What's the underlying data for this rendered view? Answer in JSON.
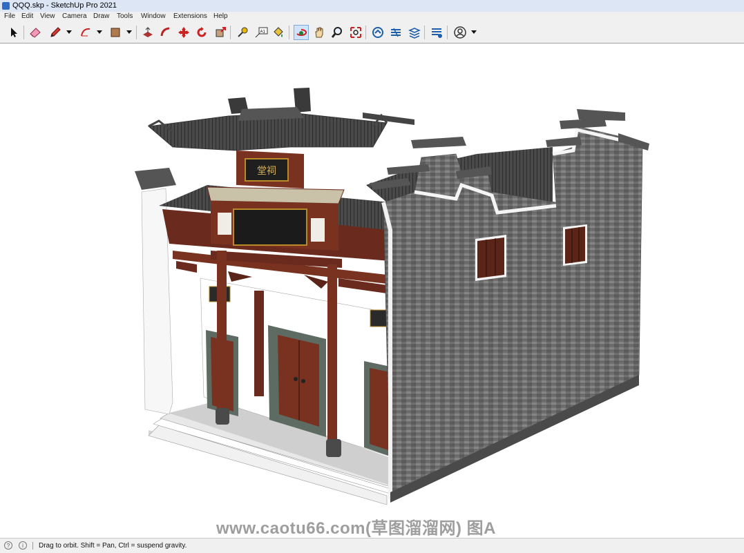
{
  "window": {
    "title": "QQQ.skp - SketchUp Pro 2021"
  },
  "menu": [
    "File",
    "Edit",
    "View",
    "Camera",
    "Draw",
    "Tools",
    "Window",
    "Extensions",
    "Help"
  ],
  "toolbar": {
    "tools": [
      "select-icon",
      "eraser-icon",
      "pencil-icon",
      "arc-icon",
      "rectangle-icon",
      "push-pull-icon",
      "follow-me-icon",
      "move-icon",
      "rotate-icon",
      "scale-icon",
      "tape-measure-icon",
      "text-icon",
      "paint-bucket-icon",
      "orbit-icon",
      "pan-icon",
      "zoom-icon",
      "zoom-extents-icon",
      "warehouse-icon",
      "extension-warehouse-icon",
      "layout-icon",
      "extension-manager-icon",
      "account-icon"
    ],
    "active_tool": "orbit-icon"
  },
  "model": {
    "sign_top": "堂祠"
  },
  "watermark": "www.caotu66.com(草图溜溜网) 图A",
  "status": {
    "hint": "Drag to orbit. Shift = Pan, Ctrl = suspend gravity."
  },
  "colors": {
    "brick": "#6f6f6f",
    "timber": "#6b2a1e",
    "roof": "#4a4a4a",
    "plaster": "#f6f6f6"
  }
}
